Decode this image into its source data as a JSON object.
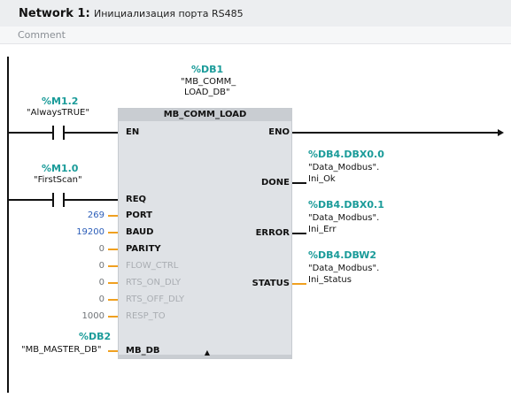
{
  "network": {
    "title": "Network 1:",
    "description": "Инициализация порта RS485",
    "comment_placeholder": "Comment"
  },
  "block": {
    "instance_address": "%DB1",
    "instance_name_line1": "\"MB_COMM_",
    "instance_name_line2": "LOAD_DB\"",
    "type": "MB_COMM_LOAD",
    "collapse_icon": "▲"
  },
  "contacts": [
    {
      "address": "%M1.2",
      "symbol": "\"AlwaysTRUE\""
    },
    {
      "address": "%M1.0",
      "symbol": "\"FirstScan\""
    }
  ],
  "inputs": [
    {
      "pin": "EN"
    },
    {
      "pin": "REQ"
    },
    {
      "pin": "PORT",
      "value": "269"
    },
    {
      "pin": "BAUD",
      "value": "19200"
    },
    {
      "pin": "PARITY",
      "value": "0"
    },
    {
      "pin": "FLOW_CTRL",
      "value": "0"
    },
    {
      "pin": "RTS_ON_DLY",
      "value": "0"
    },
    {
      "pin": "RTS_OFF_DLY",
      "value": "0"
    },
    {
      "pin": "RESP_TO",
      "value": "1000"
    },
    {
      "pin": "MB_DB",
      "address": "%DB2",
      "symbol": "\"MB_MASTER_DB\""
    }
  ],
  "outputs": [
    {
      "pin": "ENO"
    },
    {
      "pin": "DONE",
      "address": "%DB4.DBX0.0",
      "symbol_line1": "\"Data_Modbus\".",
      "symbol_line2": "Ini_Ok"
    },
    {
      "pin": "ERROR",
      "address": "%DB4.DBX0.1",
      "symbol_line1": "\"Data_Modbus\".",
      "symbol_line2": "Ini_Err"
    },
    {
      "pin": "STATUS",
      "address": "%DB4.DBW2",
      "symbol_line1": "\"Data_Modbus\".",
      "symbol_line2": "Ini_Status"
    }
  ],
  "colors": {
    "address": "#1a9b99",
    "constant": "#2b5db8",
    "connector": "#f0a020",
    "block_fill": "#dfe2e6"
  }
}
